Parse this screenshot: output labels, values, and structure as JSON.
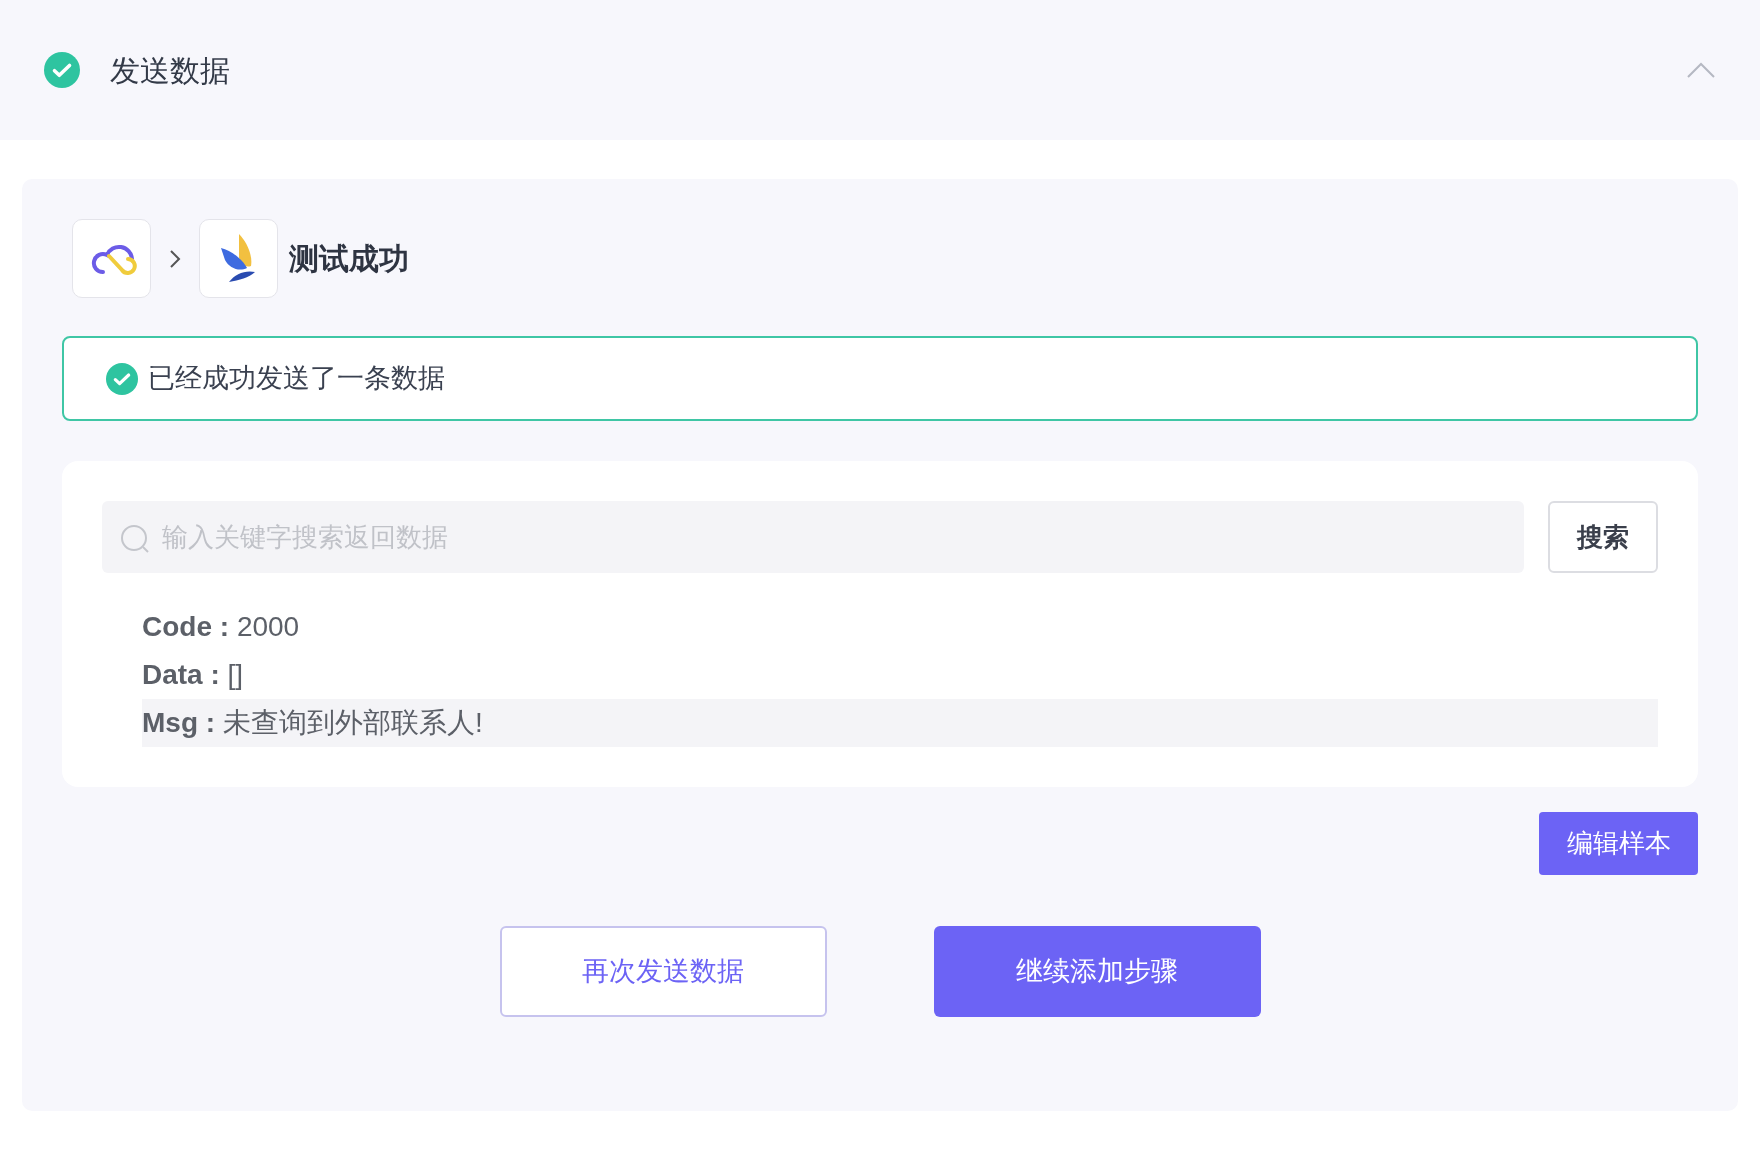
{
  "header": {
    "title": "发送数据",
    "done": true,
    "expanded": true
  },
  "flow": {
    "title": "测试成功"
  },
  "alert": {
    "text": "已经成功发送了一条数据"
  },
  "search": {
    "placeholder": "输入关键字搜索返回数据",
    "button": "搜索"
  },
  "result_fields": [
    {
      "text": "**Code :** 2000",
      "highlighted": false
    },
    {
      "text": "**Data :** []",
      "highlighted": false
    },
    {
      "text": "**Msg :** 未查询到外部联系人!",
      "highlighted": true
    }
  ],
  "edit_button": "编辑样本",
  "actions": [
    {
      "label": "再次发送数据",
      "kind": "outline"
    },
    {
      "label": "继续添加步骤",
      "kind": "primary"
    }
  ]
}
